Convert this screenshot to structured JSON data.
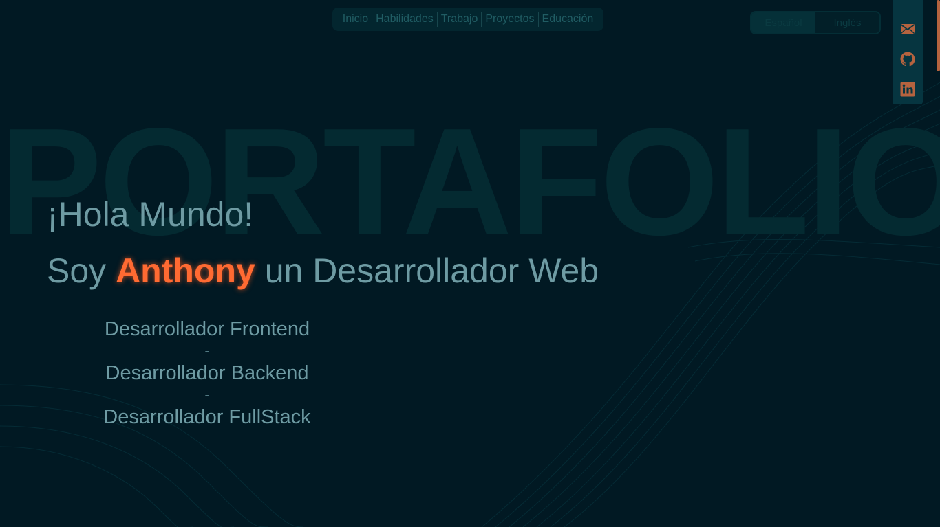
{
  "nav": {
    "items": [
      "Inicio",
      "Habilidades",
      "Trabajo",
      "Proyectos",
      "Educación"
    ]
  },
  "lang": {
    "spanish": "Español",
    "english": "Inglés"
  },
  "social": {
    "icons": [
      "mail-icon",
      "github-icon",
      "linkedin-icon"
    ],
    "accent": "#b5633f"
  },
  "hero": {
    "watermark": "PORTAFOLIO",
    "greeting": "¡Hola Mundo!",
    "intro_prefix": "Soy ",
    "name": "Anthony",
    "intro_suffix": " un Desarrollador Web",
    "roles": [
      "Desarrollador Frontend",
      "Desarrollador Backend",
      "Desarrollador FullStack"
    ],
    "separator": "-"
  },
  "colors": {
    "background": "#011923",
    "text": "#6e9ba3",
    "highlight": "#ff6a32"
  }
}
